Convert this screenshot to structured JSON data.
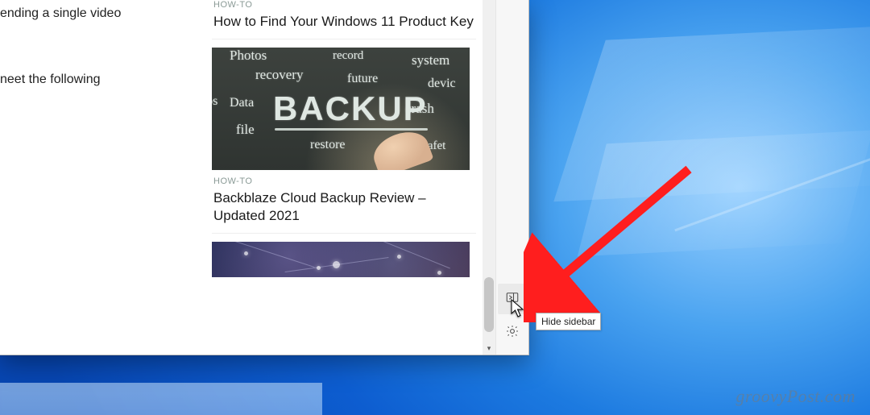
{
  "main": {
    "line1": "ending a single video",
    "line2": "neet the following"
  },
  "feed": {
    "cards": [
      {
        "category": "HOW-TO",
        "title": "How to Find Your Windows 11 Product Key"
      },
      {
        "category": "HOW-TO",
        "title": "Backblaze Cloud Backup Review – Updated 2021"
      }
    ],
    "backup_thumb_words": {
      "big": "BACKUP",
      "small": [
        "Photos",
        "recovery",
        "record",
        "system",
        "future",
        "devic",
        "eos",
        "Data",
        "crash",
        "file",
        "restore",
        "safet"
      ]
    }
  },
  "tooltip": "Hide sidebar",
  "watermark": "groovyPost.com"
}
